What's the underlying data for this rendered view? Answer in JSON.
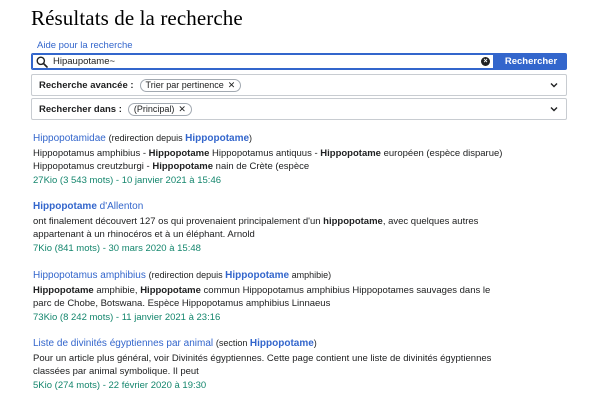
{
  "page": {
    "title": "Résultats de la recherche",
    "help_link": "Aide pour la recherche"
  },
  "search": {
    "value": "Hipaupotame~",
    "button_label": "Rechercher"
  },
  "filters": {
    "advanced": {
      "label": "Recherche avancée :",
      "chip": "Trier par pertinence"
    },
    "namespaces": {
      "label": "Rechercher dans :",
      "chip": "(Principal)"
    }
  },
  "results": [
    {
      "title": "Hippopotamidae",
      "redirect_prefix": "(redirection depuis ",
      "redirect_target": "Hippopotame",
      "redirect_suffix": ")",
      "snippet_1a": "Hippopotamus amphibius - ",
      "snippet_1b": "Hippopotame",
      "snippet_1c": " Hippopotamus antiquus - ",
      "snippet_1d": "Hippopotame",
      "snippet_1e": " européen (espèce disparue)",
      "snippet_2a": "Hippopotamus creutzburgi - ",
      "snippet_2b": "Hippopotame",
      "snippet_2c": " nain de Crète (espèce",
      "meta": "27Kio (3 543 mots) - 10 janvier 2021 à 15:46"
    },
    {
      "title_bold": "Hippopotame",
      "title_rest": " d'Allenton",
      "snippet_1a": "ont finalement découvert 127 os qui provenaient principalement d'un ",
      "snippet_1b": "hippopotame",
      "snippet_1c": ", avec quelques autres",
      "snippet_2": "appartenant à un rhinocéros et à un éléphant. Arnold",
      "meta": "7Kio (841 mots) - 30 mars 2020 à 15:48"
    },
    {
      "title": "Hippopotamus amphibius",
      "redirect_prefix": "(redirection depuis ",
      "redirect_target": "Hippopotame",
      "redirect_suffix": " amphibie)",
      "snippet_1a": "Hippopotame",
      "snippet_1b": " amphibie, ",
      "snippet_1c": "Hippopotame",
      "snippet_1d": " commun Hippopotamus amphibius Hippopotames sauvages dans le",
      "snippet_2": "parc de Chobe, Botswana. Espèce Hippopotamus amphibius Linnaeus",
      "meta": "73Kio (8 242 mots) - 11 janvier 2021 à 23:16"
    },
    {
      "title": "Liste de divinités égyptiennes par animal",
      "section_prefix": "(section ",
      "section_target": "Hippopotame",
      "section_suffix": ")",
      "snippet_1": "Pour un article plus général, voir Divinités égyptiennes. Cette page contient une liste de divinités égyptiennes",
      "snippet_2": "classées par animal symbolique. Il peut",
      "meta": "5Kio (274 mots) - 22 février 2020 à 19:30"
    }
  ]
}
